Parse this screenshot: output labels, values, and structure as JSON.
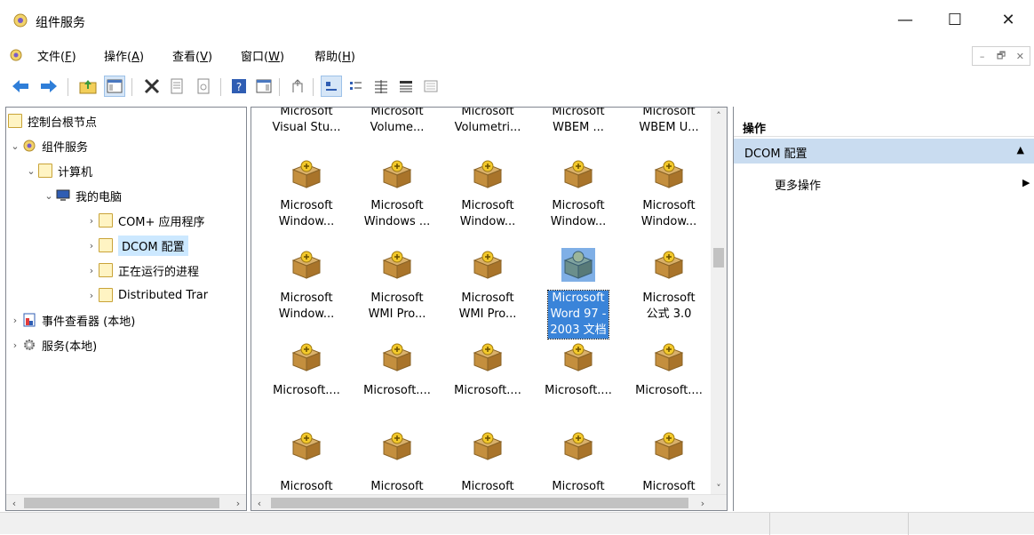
{
  "window": {
    "title": "组件服务",
    "minimize": "—",
    "maximize": "☐",
    "close": "✕"
  },
  "menu": [
    {
      "label": "文件(",
      "key": "F",
      "suffix": ")"
    },
    {
      "label": "操作(",
      "key": "A",
      "suffix": ")"
    },
    {
      "label": "查看(",
      "key": "V",
      "suffix": ")"
    },
    {
      "label": "窗口(",
      "key": "W",
      "suffix": ")"
    },
    {
      "label": "帮助(",
      "key": "H",
      "suffix": ")"
    }
  ],
  "mdi": {
    "minimize": "–",
    "restore": "🗗",
    "close": "✕"
  },
  "tree": [
    {
      "label": "控制台根节点"
    },
    {
      "label": "组件服务"
    },
    {
      "label": "计算机"
    },
    {
      "label": "我的电脑"
    },
    {
      "label": "COM+ 应用程序"
    },
    {
      "label": "DCOM 配置"
    },
    {
      "label": "正在运行的进程"
    },
    {
      "label": "Distributed Trar"
    },
    {
      "label": "事件查看器 (本地)"
    },
    {
      "label": "服务(本地)"
    }
  ],
  "grid": {
    "row0": [
      {
        "l1": "Microsoft",
        "l2": "Visual Stu..."
      },
      {
        "l1": "Microsoft",
        "l2": "Volume..."
      },
      {
        "l1": "Microsoft",
        "l2": "Volumetri..."
      },
      {
        "l1": "Microsoft",
        "l2": "WBEM ..."
      },
      {
        "l1": "Microsoft",
        "l2": "WBEM U..."
      }
    ],
    "row1": [
      {
        "l1": "Microsoft",
        "l2": "Window..."
      },
      {
        "l1": "Microsoft",
        "l2": "Windows ..."
      },
      {
        "l1": "Microsoft",
        "l2": "Window..."
      },
      {
        "l1": "Microsoft",
        "l2": "Window..."
      },
      {
        "l1": "Microsoft",
        "l2": "Window..."
      }
    ],
    "row2": [
      {
        "l1": "Microsoft",
        "l2": "Window..."
      },
      {
        "l1": "Microsoft",
        "l2": "WMI Pro..."
      },
      {
        "l1": "Microsoft",
        "l2": "WMI Pro..."
      },
      {
        "l1": "Microsoft",
        "l2": "Word 97 -",
        "l3": "2003 文档"
      },
      {
        "l1": "Microsoft",
        "l2": "公式 3.0"
      }
    ],
    "row3": [
      "Microsoft....",
      "Microsoft....",
      "Microsoft....",
      "Microsoft....",
      "Microsoft...."
    ],
    "row4": [
      "Microsoft",
      "Microsoft",
      "Microsoft",
      "Microsoft",
      "Microsoft"
    ]
  },
  "actions": {
    "header": "操作",
    "section": "DCOM 配置",
    "more": "更多操作"
  }
}
